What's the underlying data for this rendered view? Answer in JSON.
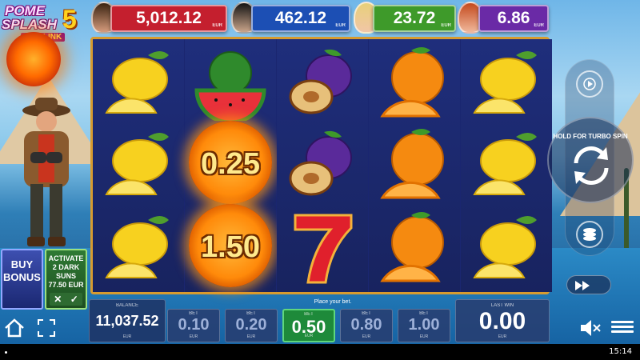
{
  "logo": {
    "line1": "POME",
    "line2": "SPLASH",
    "number": "5",
    "sub": "SUN LINK"
  },
  "jackpots": [
    {
      "amount": "5,012.12",
      "currency": "EUR",
      "color": "#c41f2e"
    },
    {
      "amount": "462.12",
      "currency": "EUR",
      "color": "#1c4fb4"
    },
    {
      "amount": "23.72",
      "currency": "EUR",
      "color": "#3e9a2a"
    },
    {
      "amount": "6.86",
      "currency": "EUR",
      "color": "#6a2aa6"
    }
  ],
  "reels": [
    [
      "lemon-icon",
      "lemon-icon",
      "lemon-icon"
    ],
    [
      "watermelon-icon",
      "sun-coin",
      "sun-coin"
    ],
    [
      "plum-icon",
      "plum-icon",
      "seven-icon"
    ],
    [
      "orange-icon",
      "orange-icon",
      "orange-icon"
    ],
    [
      "lemon-icon",
      "lemon-icon",
      "lemon-icon"
    ]
  ],
  "sun_coins": [
    "0.25",
    "1.50"
  ],
  "buy_bonus": {
    "label_line1": "BUY",
    "label_line2": "BONUS"
  },
  "activate": {
    "line1": "ACTIVATE",
    "line2": "2 DARK",
    "line3": "SUNS",
    "line4": "77.50 EUR",
    "cancel": "✕",
    "confirm": "✓"
  },
  "spin_panel": {
    "turbo_text": "HOLD FOR TURBO SPIN"
  },
  "bottom": {
    "balance_label": "BALANCE",
    "balance": "11,037.52",
    "balance_currency": "EUR",
    "place_bet": "Place your bet.",
    "bets": [
      {
        "label": "BET",
        "value": "0.10",
        "currency": "EUR",
        "selected": false
      },
      {
        "label": "BET",
        "value": "0.20",
        "currency": "EUR",
        "selected": false
      },
      {
        "label": "BET",
        "value": "0.50",
        "currency": "EUR",
        "selected": true
      },
      {
        "label": "BET",
        "value": "0.80",
        "currency": "EUR",
        "selected": false
      },
      {
        "label": "BET",
        "value": "1.00",
        "currency": "EUR",
        "selected": false
      }
    ],
    "last_win_label": "LAST WIN",
    "last_win": "0.00",
    "last_win_currency": "EUR"
  },
  "status": {
    "clock": "15:14"
  }
}
